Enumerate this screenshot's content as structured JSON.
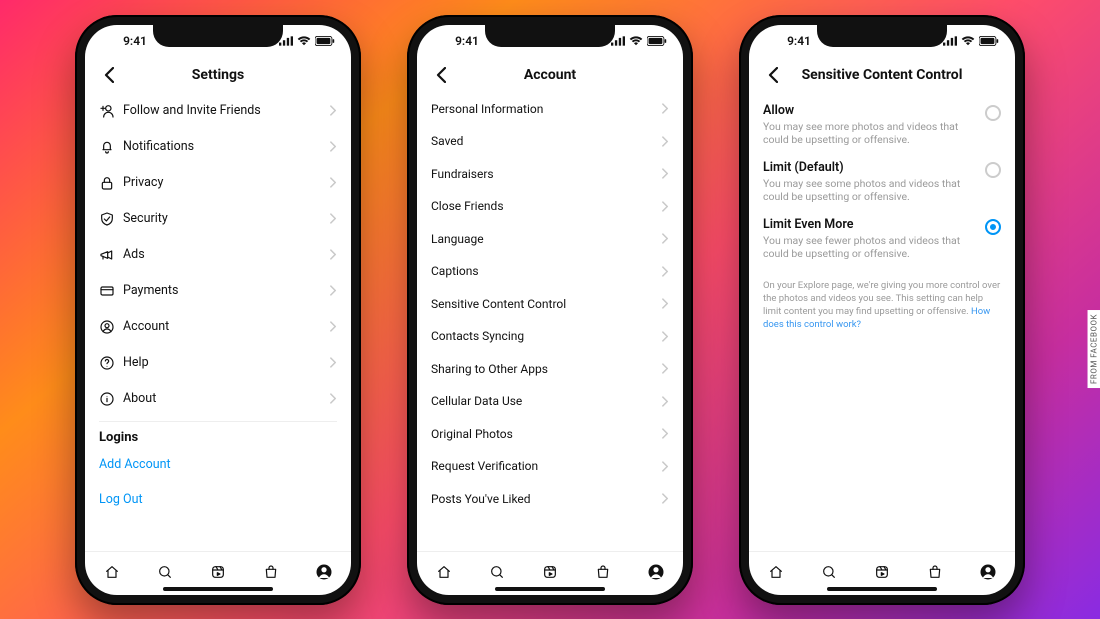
{
  "credit": "FROM FACEBOOK",
  "status": {
    "time": "9:41"
  },
  "phone1": {
    "title": "Settings",
    "items": [
      {
        "icon": "add-person-icon",
        "label": "Follow and Invite Friends"
      },
      {
        "icon": "bell-icon",
        "label": "Notifications"
      },
      {
        "icon": "lock-icon",
        "label": "Privacy"
      },
      {
        "icon": "shield-icon",
        "label": "Security"
      },
      {
        "icon": "megaphone-icon",
        "label": "Ads"
      },
      {
        "icon": "card-icon",
        "label": "Payments"
      },
      {
        "icon": "user-circle-icon",
        "label": "Account"
      },
      {
        "icon": "help-icon",
        "label": "Help"
      },
      {
        "icon": "info-icon",
        "label": "About"
      }
    ],
    "logins_title": "Logins",
    "add_account": "Add Account",
    "log_out": "Log Out"
  },
  "phone2": {
    "title": "Account",
    "items": [
      "Personal Information",
      "Saved",
      "Fundraisers",
      "Close Friends",
      "Language",
      "Captions",
      "Sensitive Content Control",
      "Contacts Syncing",
      "Sharing to Other Apps",
      "Cellular Data Use",
      "Original Photos",
      "Request Verification",
      "Posts You've Liked"
    ]
  },
  "phone3": {
    "title": "Sensitive Content Control",
    "options": [
      {
        "title": "Allow",
        "sub": "You may see more photos and videos that could be upsetting or offensive.",
        "selected": false
      },
      {
        "title": "Limit (Default)",
        "sub": "You may see some photos and videos that could be upsetting or offensive.",
        "selected": false
      },
      {
        "title": "Limit Even More",
        "sub": "You may see fewer photos and videos that could be upsetting or offensive.",
        "selected": true
      }
    ],
    "footnote_a": "On your Explore page, we're giving you more control over the photos and videos you see. This setting can help limit content you may find upsetting or offensive. ",
    "footnote_link": "How does this control work?"
  },
  "nav": [
    "home-icon",
    "search-icon",
    "reels-icon",
    "shop-icon",
    "profile-icon"
  ]
}
